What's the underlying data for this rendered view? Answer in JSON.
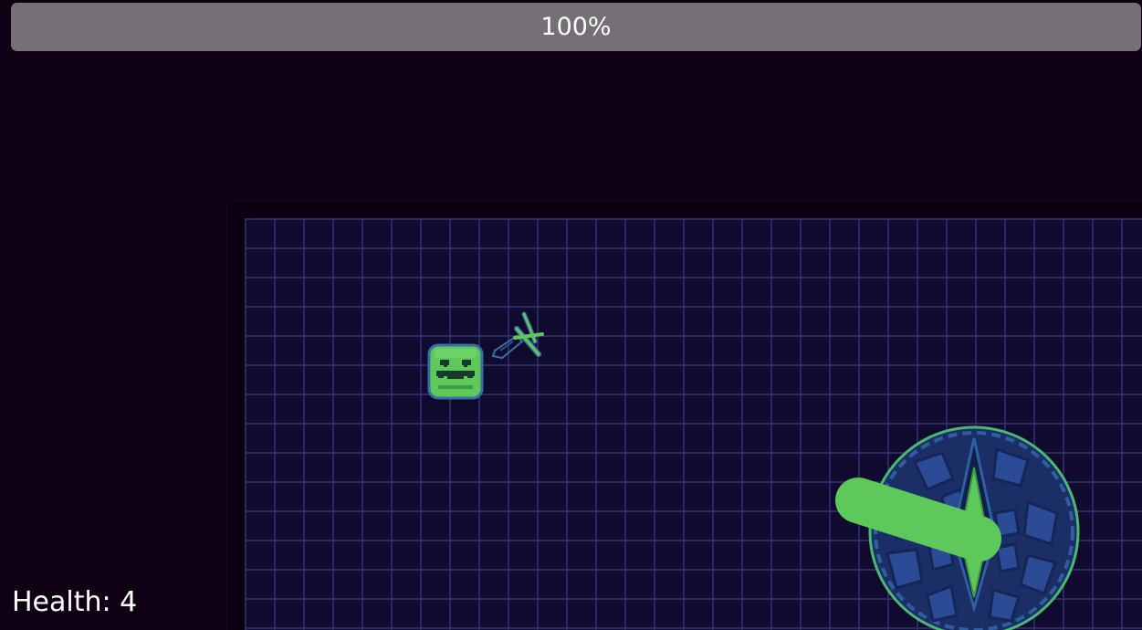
{
  "hud": {
    "progress_label": "100%",
    "progress_fraction": 1.0,
    "health_text": "Health: 4"
  },
  "colors": {
    "background": "#0f0014",
    "arena_floor": "#100a2e",
    "grid_line": "#2c2a63",
    "player_green": "#5ec95a",
    "outline_blue": "#2f5fa0",
    "boss_body": "#223e80",
    "progress_fill": "#757076"
  },
  "icons": {
    "player": "slime-face-icon",
    "weapon": "sword-icon",
    "boss": "spiked-shell-boss-icon"
  }
}
